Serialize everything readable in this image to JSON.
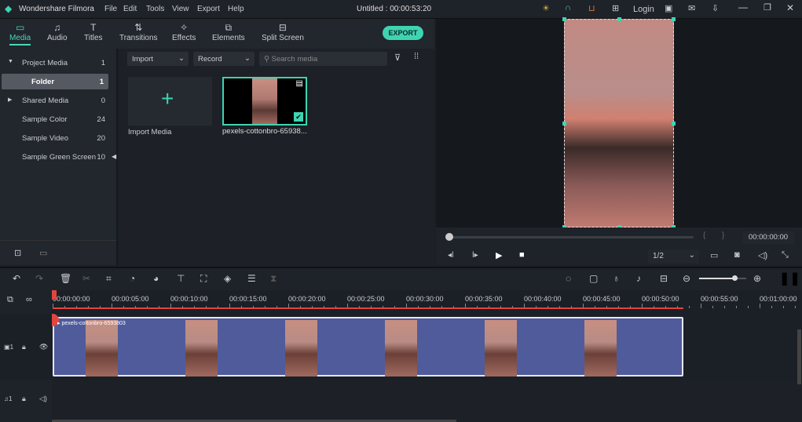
{
  "app": {
    "name": "Wondershare Filmora",
    "menu": [
      "File",
      "Edit",
      "Tools",
      "View",
      "Export",
      "Help"
    ],
    "project_title": "Untitled : 00:00:53:20",
    "login": "Login"
  },
  "tabs": [
    {
      "label": "Media",
      "icon": "folder"
    },
    {
      "label": "Audio",
      "icon": "music-note"
    },
    {
      "label": "Titles",
      "icon": "text-T"
    },
    {
      "label": "Transitions",
      "icon": "transition"
    },
    {
      "label": "Effects",
      "icon": "sparkle"
    },
    {
      "label": "Elements",
      "icon": "shapes"
    },
    {
      "label": "Split Screen",
      "icon": "split-screen"
    }
  ],
  "export_label": "EXPORT",
  "sidebar": [
    {
      "label": "Project Media",
      "count": "1"
    },
    {
      "label": "Folder",
      "count": "1"
    },
    {
      "label": "Shared Media",
      "count": "0"
    },
    {
      "label": "Sample Color",
      "count": "24"
    },
    {
      "label": "Sample Video",
      "count": "20"
    },
    {
      "label": "Sample Green Screen",
      "count": "10"
    }
  ],
  "media": {
    "import": "Import",
    "record": "Record",
    "search_placeholder": "Search media",
    "import_media": "Import Media",
    "clip_name": "pexels-cottonbro-65938..."
  },
  "player": {
    "timecode": "00:00:00:00",
    "quality": "1/2",
    "progress": 0
  },
  "timeline": {
    "ruler": [
      "00:00:00:00",
      "00:00:05:00",
      "00:00:10:00",
      "00:00:15:00",
      "00:00:20:00",
      "00:00:25:00",
      "00:00:30:00",
      "00:00:35:00",
      "00:00:40:00",
      "00:00:45:00",
      "00:00:50:00",
      "00:00:55:00",
      "00:01:00:00"
    ],
    "clip_label": "pexels-cottonbro-6593803",
    "video_track": "1",
    "audio_track": "1",
    "zoom_level": 0.75
  },
  "colors": {
    "accent": "#3ed4b2",
    "playhead": "#e0463e",
    "clip": "#505b9b"
  }
}
